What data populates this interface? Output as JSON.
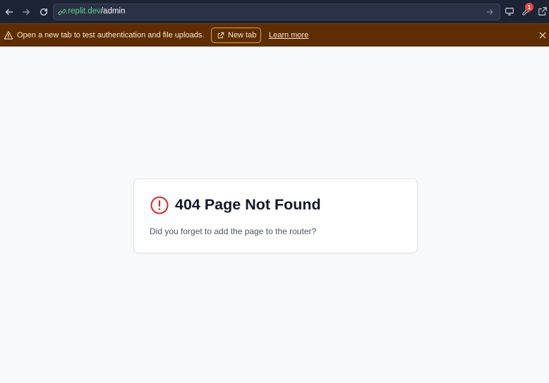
{
  "toolbar": {
    "url_domain": ".replit.dev",
    "url_path": "/admin",
    "notification_count": "1"
  },
  "banner": {
    "message": "Open a new tab to test authentication and file uploads.",
    "new_tab_label": "New tab",
    "learn_more_label": "Learn more"
  },
  "error_card": {
    "title": "404 Page Not Found",
    "message": "Did you forget to add the page to the router?"
  },
  "colors": {
    "toolbar_bg": "#1c2333",
    "banner_bg": "#5e2d04",
    "domain_green": "#5fd38b",
    "error_red": "#dc2626",
    "page_bg": "#f8f9fb"
  }
}
